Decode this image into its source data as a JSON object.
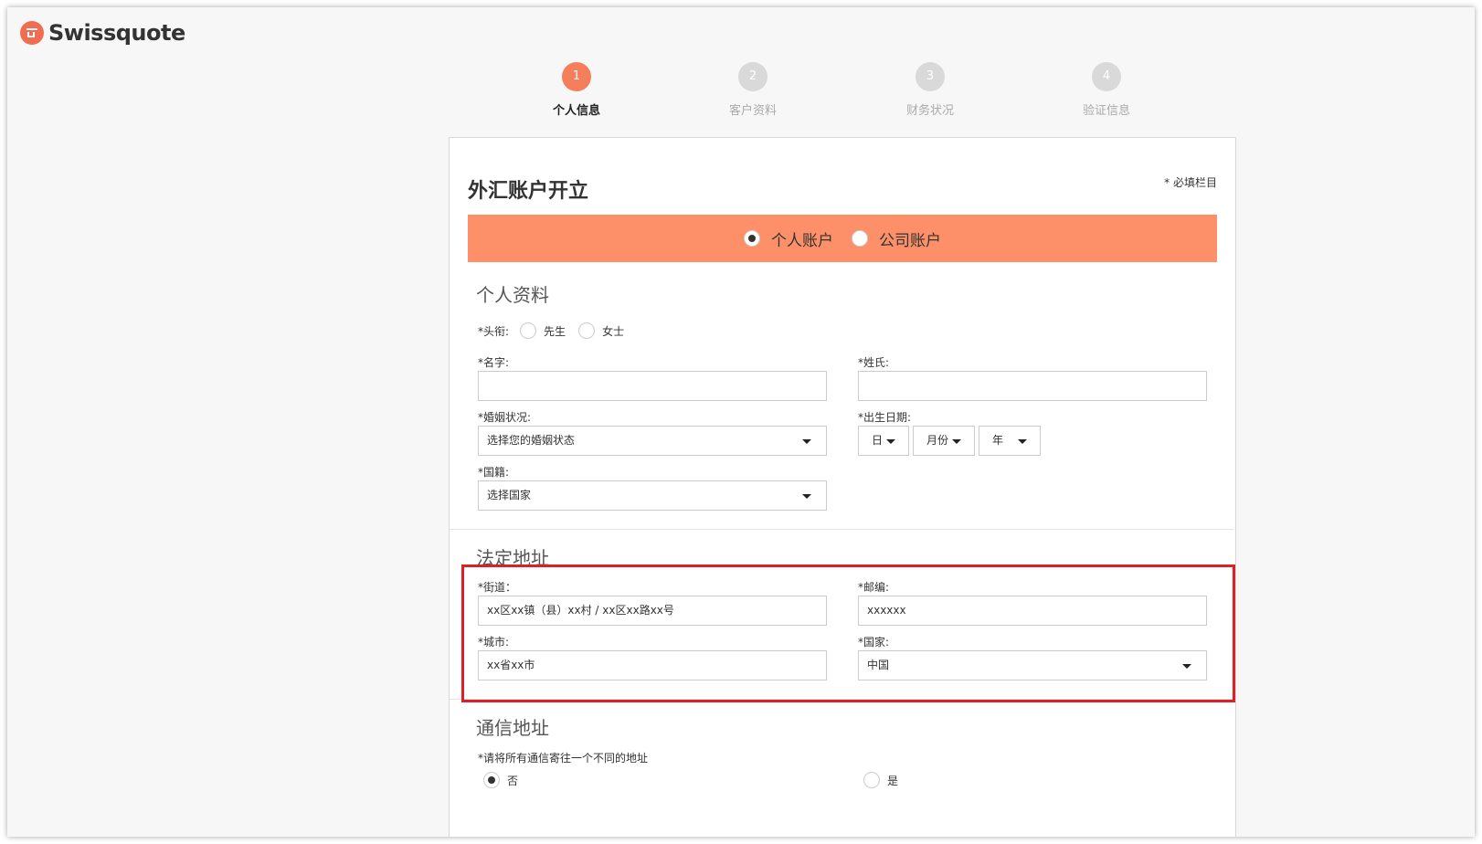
{
  "brand": {
    "name": "Swissquote",
    "logo_icon": "swissquote-logo-icon",
    "accent": "#f47f5a"
  },
  "steps": [
    {
      "number": "1",
      "label": "个人信息",
      "active": true
    },
    {
      "number": "2",
      "label": "客户资料",
      "active": false
    },
    {
      "number": "3",
      "label": "财务状况",
      "active": false
    },
    {
      "number": "4",
      "label": "验证信息",
      "active": false
    }
  ],
  "form": {
    "title": "外汇账户开立",
    "required_note": "* 必填栏目",
    "account_type": {
      "options": [
        "个人账户",
        "公司账户"
      ],
      "selected": "个人账户",
      "banner_color": "#fd9068"
    },
    "personal": {
      "section_title": "个人资料",
      "title_label": "*头衔:",
      "title_options": [
        "先生",
        "女士"
      ],
      "first_name_label": "*名字:",
      "first_name_value": "",
      "last_name_label": "*姓氏:",
      "last_name_value": "",
      "marital_label": "*婚姻状况:",
      "marital_value": "选择您的婚姻状态",
      "dob_label": "*出生日期:",
      "dob_day": "日",
      "dob_month": "月份",
      "dob_year": "年",
      "nationality_label": "*国籍:",
      "nationality_value": "选择国家"
    },
    "legal_address": {
      "section_title": "法定地址",
      "street_label": "*街道：",
      "street_value": "xx区xx镇（县）xx村 / xx区xx路xx号",
      "postcode_label": "*邮编:",
      "postcode_value": "xxxxxx",
      "city_label": "*城市:",
      "city_value": "xx省xx市",
      "country_label": "*国家:",
      "country_value": "中国",
      "highlight_color": "#e01e26"
    },
    "mailing_address": {
      "section_title": "通信地址",
      "question": "*请将所有通信寄往一个不同的地址",
      "options": [
        "否",
        "是"
      ],
      "selected": "否"
    }
  }
}
